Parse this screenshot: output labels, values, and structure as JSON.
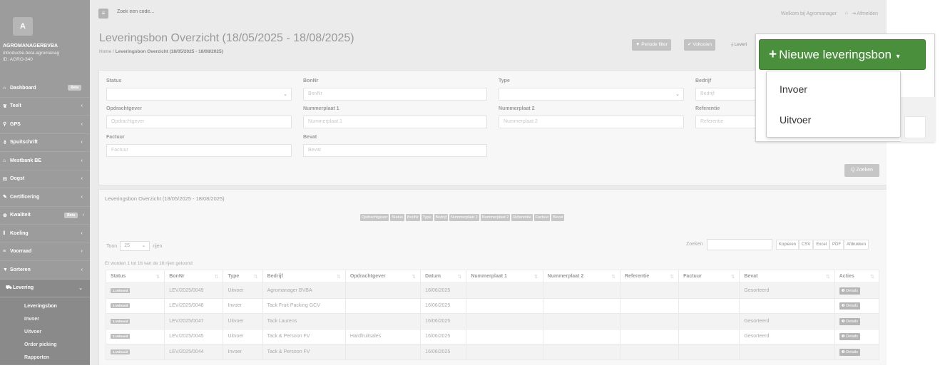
{
  "sidebar": {
    "logo_letter": "A",
    "company": "AGROMANAGERBVBA",
    "subtitle_lines": [
      "introductie.beta.agromanag",
      "ID: AGRO-340"
    ],
    "items": [
      {
        "label": "Dashboard",
        "icon": "home-icon",
        "glyph": "⌂",
        "badge": "Beta",
        "chevron": ""
      },
      {
        "label": "Teelt",
        "icon": "leaf-icon",
        "glyph": "❦",
        "badge": "",
        "chevron": "‹"
      },
      {
        "label": "GPS",
        "icon": "map-pin-icon",
        "glyph": "⚲",
        "badge": "",
        "chevron": "‹"
      },
      {
        "label": "Spuitschrift",
        "icon": "droplet-icon",
        "glyph": "⚱",
        "badge": "",
        "chevron": "‹"
      },
      {
        "label": "Mestbank BE",
        "icon": "bank-icon",
        "glyph": "⌂",
        "badge": "",
        "chevron": "‹"
      },
      {
        "label": "Oogst",
        "icon": "basket-icon",
        "glyph": "⊟",
        "badge": "",
        "chevron": "‹"
      },
      {
        "label": "Certificering",
        "icon": "certificate-icon",
        "glyph": "✎",
        "badge": "",
        "chevron": "‹"
      },
      {
        "label": "Kwaliteit",
        "icon": "quality-icon",
        "glyph": "⊕",
        "badge": "Beta",
        "chevron": "‹"
      },
      {
        "label": "Koeling",
        "icon": "thermometer-icon",
        "glyph": "ǁ",
        "badge": "",
        "chevron": "‹"
      },
      {
        "label": "Voorraad",
        "icon": "inventory-icon",
        "glyph": "≡",
        "badge": "",
        "chevron": "‹"
      },
      {
        "label": "Sorteren",
        "icon": "filter-icon",
        "glyph": "▼",
        "badge": "",
        "chevron": "‹"
      }
    ],
    "active": {
      "label": "Levering",
      "icon": "truck-icon",
      "glyph": "⛟",
      "chevron": "⌄"
    },
    "subitems": [
      "Leveringsbon",
      "Invoer",
      "Uitvoer",
      "Order picking",
      "Rapporten"
    ]
  },
  "topbar": {
    "menu_icon": "≡",
    "search_placeholder": "Zoek een code...",
    "welcome": "Welkom bij Agromanager",
    "home_icon": "⌂",
    "logout": "⇥ Afmelden"
  },
  "header": {
    "title": "Leveringsbon Overzicht (18/05/2025 - 18/08/2025)",
    "breadcrumb_home": "Home",
    "breadcrumb_sep": "/",
    "breadcrumb_current": "Leveringsbon Overzicht (18/05/2025 - 18/08/2025)",
    "btn_period": "▼ Periode filter",
    "btn_complete": "✔ Voltooien",
    "btn_export": "⤓ Leveri"
  },
  "filters": {
    "status_label": "Status",
    "bonnr_label": "BonNr",
    "bonnr_placeholder": "BonNr",
    "type_label": "Type",
    "bedrijf_label": "Bedrijf",
    "bedrijf_placeholder": "Bedrijf",
    "opdrachtgever_label": "Opdrachtgever",
    "opdrachtgever_placeholder": "Opdrachtgever",
    "nummerplaat1_label": "Nummerplaat 1",
    "nummerplaat1_placeholder": "Nummerplaat 1",
    "nummerplaat2_label": "Nummerplaat 2",
    "nummerplaat2_placeholder": "Nummerplaat 2",
    "referentie_label": "Referentie",
    "referentie_placeholder": "Referentie",
    "factuur_label": "Factuur",
    "factuur_placeholder": "Factuur",
    "bevat_label": "Bevat",
    "bevat_placeholder": "Bevat",
    "search_button": "Q Zoeken"
  },
  "table_panel": {
    "title": "Leveringsbon Overzicht (18/05/2025 - 18/08/2025)",
    "column_toggles": [
      "Opdrachtgever",
      "Status",
      "BonNr",
      "Type",
      "Bedrijf",
      "Nummerplaat 1",
      "Nummerplaat 2",
      "Referentie",
      "Factuur",
      "Bevat"
    ],
    "show_prefix": "Toon",
    "page_size": "25",
    "show_suffix": "rijen",
    "search_label": "Zoeken",
    "exports": [
      "Kopieren",
      "CSV",
      "Excel",
      "PDF",
      "Afdrukken"
    ],
    "info": "Er worden 1 tot 16 van de 16 rijen getoond",
    "columns": [
      "Status",
      "BonNr",
      "Type",
      "Bedrijf",
      "Opdrachtgever",
      "Datum",
      "Nummerplaat 1",
      "Nummerplaat 2",
      "Referentie",
      "Factuur",
      "Bevat",
      "Acties"
    ],
    "rows": [
      {
        "status": "1.Voltooid",
        "bonnr": "LEV/2025/0049",
        "type": "Uitvoer",
        "bedrijf": "Agromanager BVBA",
        "opdrachtgever": "",
        "datum": "16/06/2025",
        "np1": "",
        "np2": "",
        "referentie": "",
        "factuur": "",
        "bevat": "Gesorteerd",
        "actie": "❶ Details"
      },
      {
        "status": "1.Voltooid",
        "bonnr": "LEV/2025/0048",
        "type": "Invoer",
        "bedrijf": "Tack Fruit Packing GCV",
        "opdrachtgever": "",
        "datum": "16/06/2025",
        "np1": "",
        "np2": "",
        "referentie": "",
        "factuur": "",
        "bevat": "",
        "actie": "❶ Details"
      },
      {
        "status": "1.Voltooid",
        "bonnr": "LEV/2025/0047",
        "type": "Uitvoer",
        "bedrijf": "Tack Laurens",
        "opdrachtgever": "",
        "datum": "16/06/2025",
        "np1": "",
        "np2": "",
        "referentie": "",
        "factuur": "",
        "bevat": "Gesorteerd",
        "actie": "❶ Details"
      },
      {
        "status": "1.Voltooid",
        "bonnr": "LEV/2025/0045",
        "type": "Uitvoer",
        "bedrijf": "Tack & Persoon FV",
        "opdrachtgever": "Hardfruitsales",
        "datum": "16/06/2025",
        "np1": "",
        "np2": "",
        "referentie": "",
        "factuur": "",
        "bevat": "Gesorteerd",
        "actie": "❶ Details"
      },
      {
        "status": "1.Voltooid",
        "bonnr": "LEV/2025/0044",
        "type": "Invoer",
        "bedrijf": "Tack & Persoon FV",
        "opdrachtgever": "",
        "datum": "16/06/2025",
        "np1": "",
        "np2": "",
        "referentie": "",
        "factuur": "",
        "bevat": "",
        "actie": "❶ Details"
      }
    ]
  },
  "new_button": {
    "plus": "+",
    "label": "Nieuwe leveringsbon",
    "caret": "▾",
    "color": "#4a8f3c"
  },
  "dropdown": {
    "items": [
      "Invoer",
      "Uitvoer"
    ]
  }
}
